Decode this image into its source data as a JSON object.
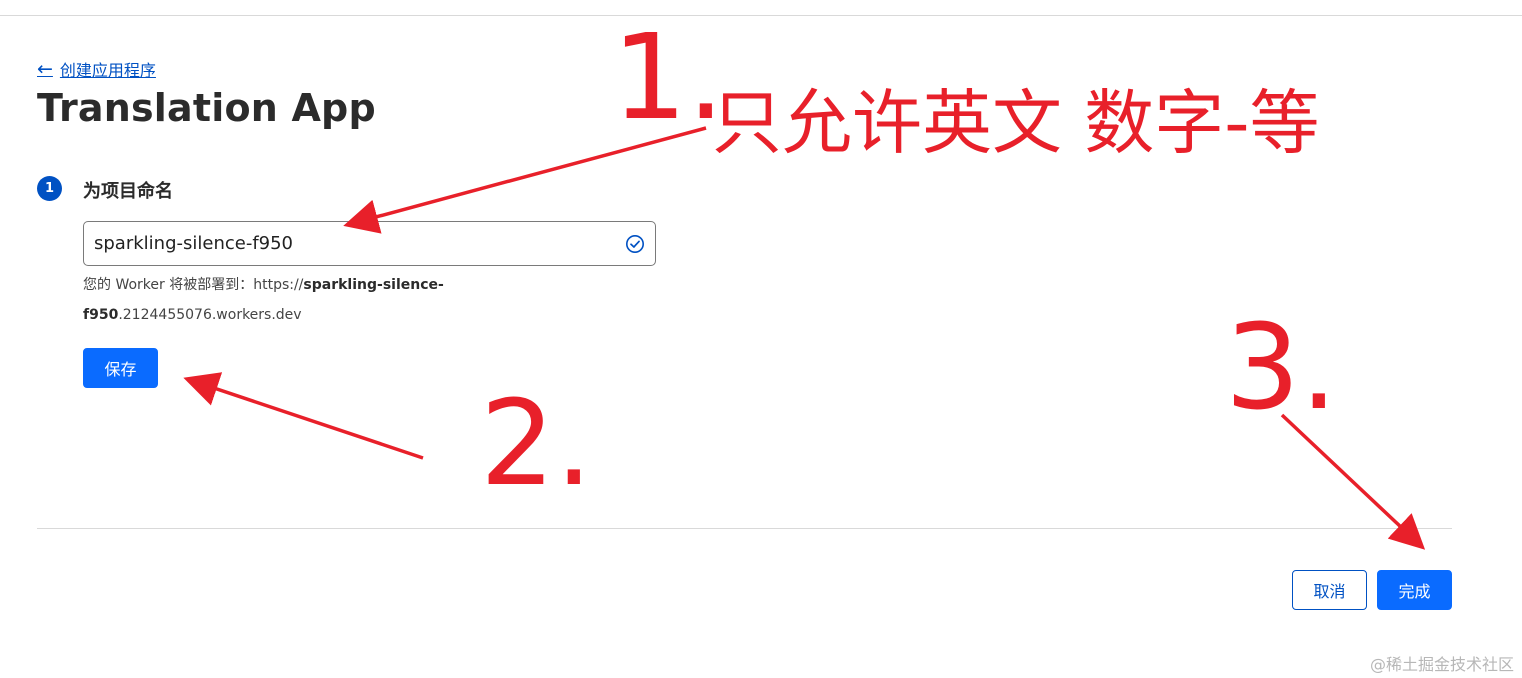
{
  "breadcrumb": {
    "arrow_icon": "arrow-left-icon",
    "label": "创建应用程序"
  },
  "page": {
    "title": "Translation App"
  },
  "step": {
    "number": "1",
    "title": "为项目命名"
  },
  "name_input": {
    "value": "sparkling-silence-f950",
    "status_icon": "check-circle-icon"
  },
  "deploy_note": {
    "prefix": "您的 Worker 将被部署到：https://",
    "name_bold_1": "sparkling-silence-",
    "name_bold_2": "f950",
    "suffix": ".2124455076.workers.dev"
  },
  "buttons": {
    "save": "保存",
    "cancel": "取消",
    "done": "完成"
  },
  "annotations": {
    "one_number": "1.",
    "one_text": "只允许英文 数字-等",
    "two_number": "2.",
    "three_number": "3.",
    "color": "#e8202a"
  },
  "watermark": "@稀土掘金技术社区",
  "colors": {
    "accent": "#0051c3",
    "primary_button": "#0a6bff"
  }
}
